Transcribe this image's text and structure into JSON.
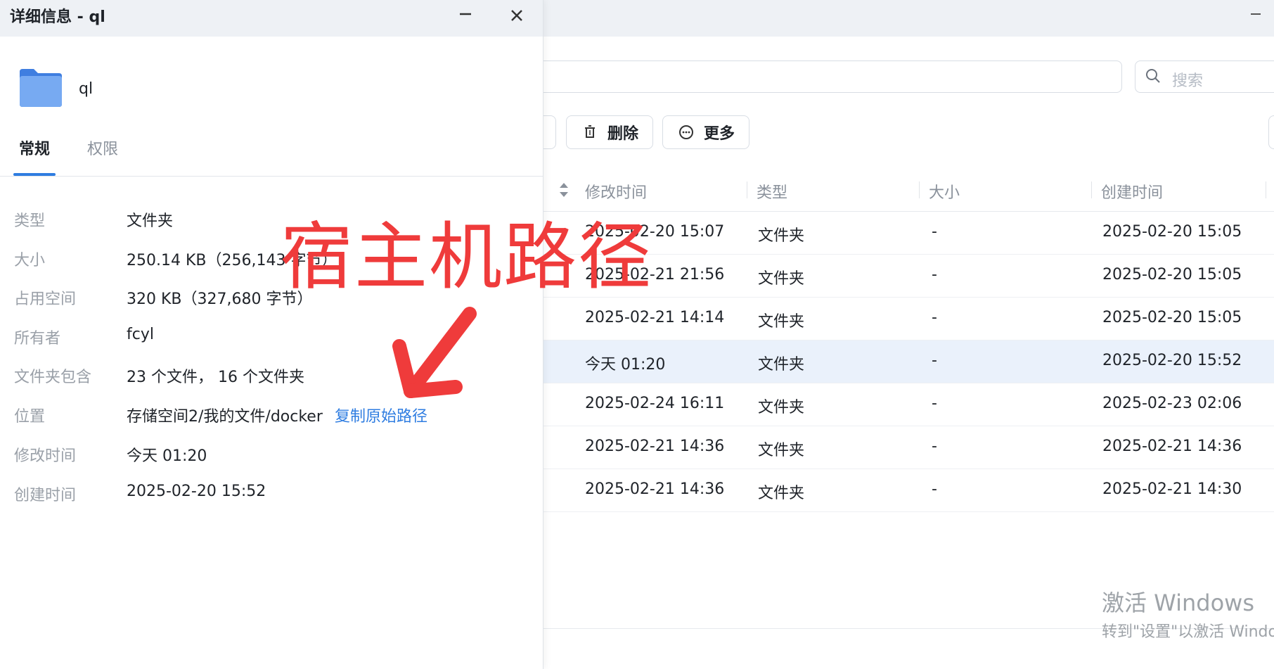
{
  "file_manager": {
    "search": {
      "placeholder": "搜索"
    },
    "toolbar": {
      "delete_label": "删除",
      "more_label": "更多"
    },
    "columns": {
      "modified": "修改时间",
      "type": "类型",
      "size": "大小",
      "created": "创建时间"
    },
    "rows": [
      {
        "modified": "2025-02-20 15:07",
        "type": "文件夹",
        "size": "-",
        "created": "2025-02-20 15:05"
      },
      {
        "modified": "2025-02-21 21:56",
        "type": "文件夹",
        "size": "-",
        "created": "2025-02-20 15:05"
      },
      {
        "modified": "2025-02-21 14:14",
        "type": "文件夹",
        "size": "-",
        "created": "2025-02-20 15:05"
      },
      {
        "modified": "今天 01:20",
        "type": "文件夹",
        "size": "-",
        "created": "2025-02-20 15:52"
      },
      {
        "modified": "2025-02-24 16:11",
        "type": "文件夹",
        "size": "-",
        "created": "2025-02-23 02:06"
      },
      {
        "modified": "2025-02-21 14:36",
        "type": "文件夹",
        "size": "-",
        "created": "2025-02-21 14:36"
      },
      {
        "modified": "2025-02-21 14:36",
        "type": "文件夹",
        "size": "-",
        "created": "2025-02-21 14:30"
      }
    ],
    "selected_row_index": 3
  },
  "dialog": {
    "title": "详细信息 - ql",
    "folder_name": "ql",
    "tabs": {
      "general": "常规",
      "permissions": "权限"
    },
    "properties": [
      {
        "label": "类型",
        "value": "文件夹"
      },
      {
        "label": "大小",
        "value": "250.14 KB（256,143 字节）"
      },
      {
        "label": "占用空间",
        "value": "320 KB（327,680 字节）"
      },
      {
        "label": "所有者",
        "value": "fcyl"
      },
      {
        "label": "文件夹包含",
        "value": "23 个文件， 16 个文件夹"
      },
      {
        "label": "位置",
        "value": "存储空间2/我的文件/docker"
      },
      {
        "label": "修改时间",
        "value": "今天 01:20"
      },
      {
        "label": "创建时间",
        "value": "2025-02-20 15:52"
      }
    ],
    "copy_path_label": "复制原始路径"
  },
  "annotation": {
    "text": "宿主机路径",
    "color": "#ef3b3b"
  },
  "watermark": {
    "title": "激活 Windows",
    "subtitle": "转到\"设置\"以激活 Windows"
  },
  "colors": {
    "accent": "#2f7de1",
    "annotation": "#ef3b3b",
    "selected_row": "#eaf1fb"
  }
}
